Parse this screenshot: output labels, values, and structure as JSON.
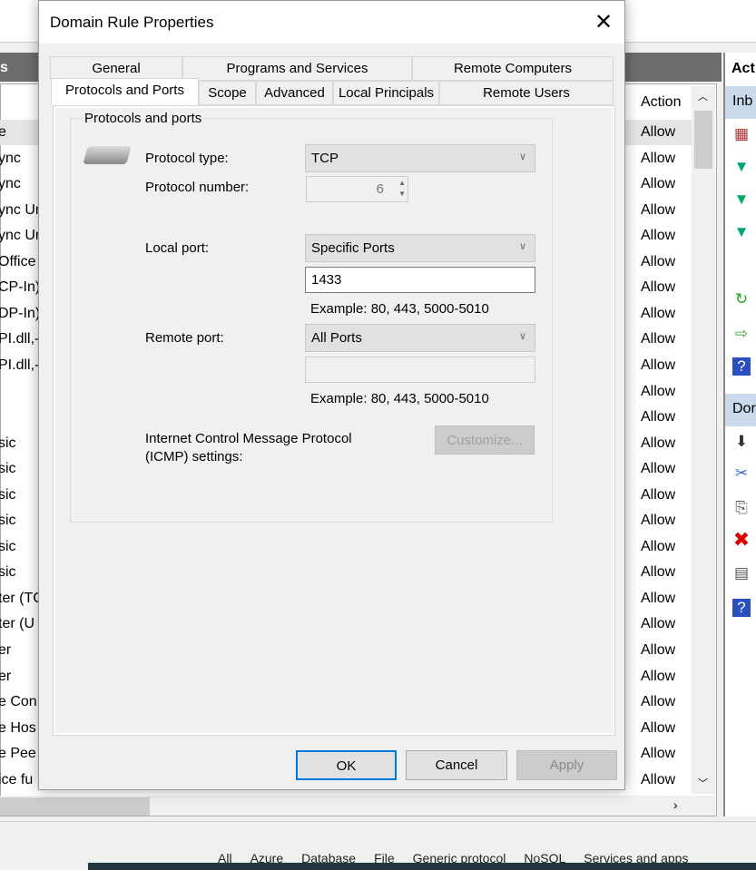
{
  "background": {
    "left_header": "s",
    "action_header": "Action",
    "rows": [
      {
        "name": "e",
        "action": "Allow"
      },
      {
        "name": "ync",
        "action": "Allow"
      },
      {
        "name": "ync",
        "action": "Allow"
      },
      {
        "name": "ync Ur",
        "action": "Allow"
      },
      {
        "name": "ync Ur",
        "action": "Allow"
      },
      {
        "name": "Office (",
        "action": "Allow"
      },
      {
        "name": "CP-In)",
        "action": "Allow"
      },
      {
        "name": "DP-In)",
        "action": "Allow"
      },
      {
        "name": "PI.dll,-",
        "action": "Allow"
      },
      {
        "name": "PI.dll,-",
        "action": "Allow"
      },
      {
        "name": "",
        "action": "Allow"
      },
      {
        "name": "",
        "action": "Allow"
      },
      {
        "name": "sic",
        "action": "Allow"
      },
      {
        "name": "sic",
        "action": "Allow"
      },
      {
        "name": "sic",
        "action": "Allow"
      },
      {
        "name": "sic",
        "action": "Allow"
      },
      {
        "name": "sic",
        "action": "Allow"
      },
      {
        "name": "sic",
        "action": "Allow"
      },
      {
        "name": "ter (TC",
        "action": "Allow"
      },
      {
        "name": "ter (U",
        "action": "Allow"
      },
      {
        "name": "er",
        "action": "Allow"
      },
      {
        "name": "er",
        "action": "Allow"
      },
      {
        "name": "e Con",
        "action": "Allow"
      },
      {
        "name": "e Hos",
        "action": "Allow"
      },
      {
        "name": "e Pee",
        "action": "Allow"
      },
      {
        "name": "ice fu",
        "action": "Allow"
      }
    ],
    "actions_pane": {
      "header": "Act",
      "section1": "Inb",
      "section2": "Dor"
    },
    "categories": [
      "All",
      "Azure",
      "Database",
      "File",
      "Generic protocol",
      "NoSQL",
      "Services and apps"
    ]
  },
  "dialog": {
    "title": "Domain Rule Properties",
    "tabs_row1": [
      "General",
      "Programs and Services",
      "Remote Computers"
    ],
    "tabs_row2": [
      "Protocols and Ports",
      "Scope",
      "Advanced",
      "Local Principals",
      "Remote Users"
    ],
    "selected_tab": "Protocols and Ports",
    "group_label": "Protocols and ports",
    "protocol_type_label": "Protocol type:",
    "protocol_type_value": "TCP",
    "protocol_number_label": "Protocol number:",
    "protocol_number_value": "6",
    "local_port_label": "Local port:",
    "local_port_mode": "Specific Ports",
    "local_port_value": "1433",
    "local_example": "Example: 80, 443, 5000-5010",
    "remote_port_label": "Remote port:",
    "remote_port_mode": "All Ports",
    "remote_port_value": "",
    "remote_example": "Example: 80, 443, 5000-5010",
    "icmp_label_1": "Internet Control Message Protocol",
    "icmp_label_2": "(ICMP) settings:",
    "customize_label": "Customize...",
    "ok_label": "OK",
    "cancel_label": "Cancel",
    "apply_label": "Apply"
  }
}
